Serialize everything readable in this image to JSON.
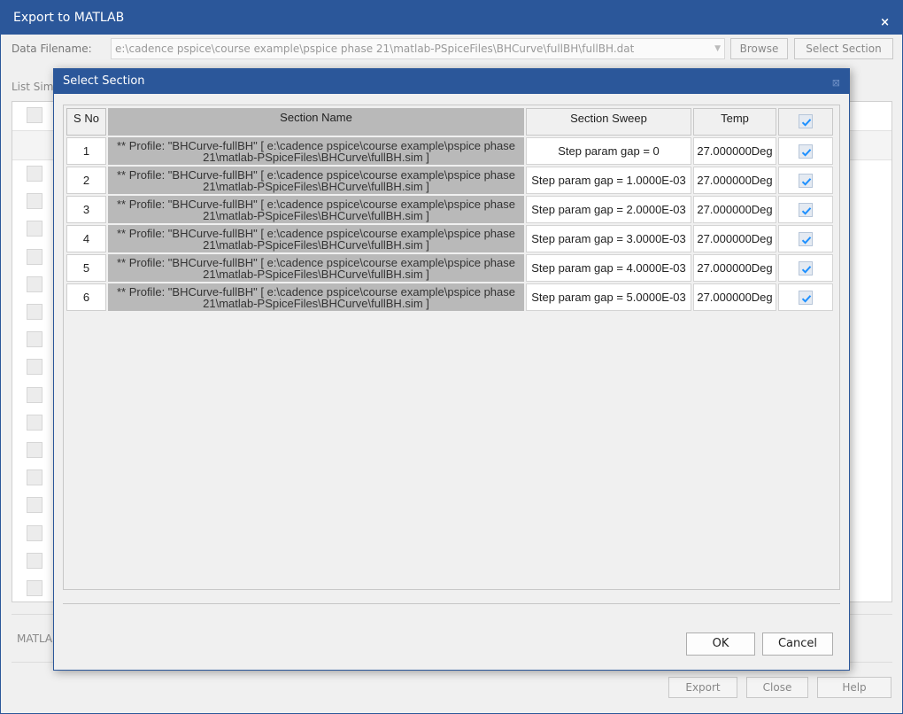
{
  "outer": {
    "title": "Export to MATLAB",
    "close_glyph": "×",
    "data_filename_label": "Data Filename:",
    "data_filename_value": "e:\\cadence pspice\\course example\\pspice phase 21\\matlab-PSpiceFiles\\BHCurve\\fullBH\\fullBH.dat",
    "dropdown_glyph": "▼",
    "browse_label": "Browse",
    "select_section_label": "Select Section",
    "list_sim_label": "List Sim",
    "matlab_label": "MATLA",
    "export_label": "Export",
    "close_label": "Close",
    "help_label": "Help"
  },
  "dialog": {
    "title": "Select Section",
    "close_glyph": "⊠",
    "columns": {
      "sno": "S No",
      "name": "Section Name",
      "sweep": "Section Sweep",
      "temp": "Temp"
    },
    "header_checked": true,
    "rows": [
      {
        "sno": "1",
        "name": "** Profile: \"BHCurve-fullBH\" [ e:\\cadence pspice\\course example\\pspice phase 21\\matlab-PSpiceFiles\\BHCurve\\fullBH.sim ]",
        "sweep": "Step param gap = 0",
        "temp": "27.000000Deg",
        "checked": true
      },
      {
        "sno": "2",
        "name": "** Profile: \"BHCurve-fullBH\" [ e:\\cadence pspice\\course example\\pspice phase 21\\matlab-PSpiceFiles\\BHCurve\\fullBH.sim ]",
        "sweep": "Step param gap = 1.0000E-03",
        "temp": "27.000000Deg",
        "checked": true
      },
      {
        "sno": "3",
        "name": "** Profile: \"BHCurve-fullBH\" [ e:\\cadence pspice\\course example\\pspice phase 21\\matlab-PSpiceFiles\\BHCurve\\fullBH.sim ]",
        "sweep": "Step param gap = 2.0000E-03",
        "temp": "27.000000Deg",
        "checked": true
      },
      {
        "sno": "4",
        "name": "** Profile: \"BHCurve-fullBH\" [ e:\\cadence pspice\\course example\\pspice phase 21\\matlab-PSpiceFiles\\BHCurve\\fullBH.sim ]",
        "sweep": "Step param gap = 3.0000E-03",
        "temp": "27.000000Deg",
        "checked": true
      },
      {
        "sno": "5",
        "name": "** Profile: \"BHCurve-fullBH\" [ e:\\cadence pspice\\course example\\pspice phase 21\\matlab-PSpiceFiles\\BHCurve\\fullBH.sim ]",
        "sweep": "Step param gap = 4.0000E-03",
        "temp": "27.000000Deg",
        "checked": true
      },
      {
        "sno": "6",
        "name": "** Profile: \"BHCurve-fullBH\" [ e:\\cadence pspice\\course example\\pspice phase 21\\matlab-PSpiceFiles\\BHCurve\\fullBH.sim ]",
        "sweep": "Step param gap = 5.0000E-03",
        "temp": "27.000000Deg",
        "checked": true
      }
    ],
    "ok_label": "OK",
    "cancel_label": "Cancel"
  },
  "colors": {
    "title_bar": "#2b579a",
    "check_mark": "#1e90ff",
    "section_name_cell": "#b9b9b9"
  }
}
